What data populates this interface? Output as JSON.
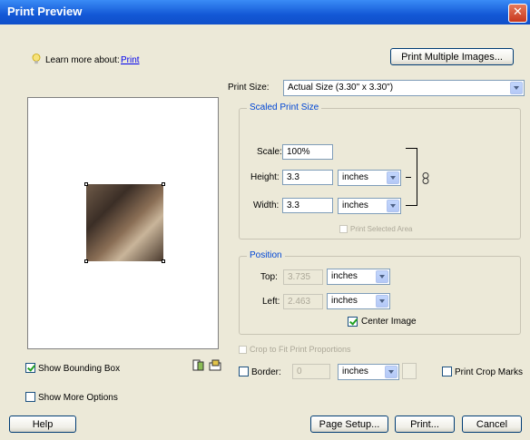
{
  "window": {
    "title": "Print Preview"
  },
  "learn_more": {
    "label": "Learn more about:",
    "link": "Print"
  },
  "buttons": {
    "print_multiple": "Print Multiple Images...",
    "help": "Help",
    "page_setup": "Page Setup...",
    "print": "Print...",
    "cancel": "Cancel"
  },
  "print_size": {
    "label": "Print Size:",
    "value": "Actual Size (3.30\" x 3.30\")"
  },
  "scaled": {
    "title": "Scaled Print Size",
    "scale_label": "Scale:",
    "scale": "100%",
    "height_label": "Height:",
    "height": "3.3",
    "height_unit": "inches",
    "width_label": "Width:",
    "width": "3.3",
    "width_unit": "inches",
    "print_selected": "Print Selected Area"
  },
  "position": {
    "title": "Position",
    "top_label": "Top:",
    "top": "3.735",
    "top_unit": "inches",
    "left_label": "Left:",
    "left": "2.463",
    "left_unit": "inches",
    "center_image": "Center Image"
  },
  "crop_fit": "Crop to Fit Print Proportions",
  "border": {
    "label": "Border:",
    "value": "0",
    "unit": "inches"
  },
  "print_crop_marks": "Print Crop Marks",
  "show_bounding_box": "Show Bounding Box",
  "show_more_options": "Show More Options"
}
